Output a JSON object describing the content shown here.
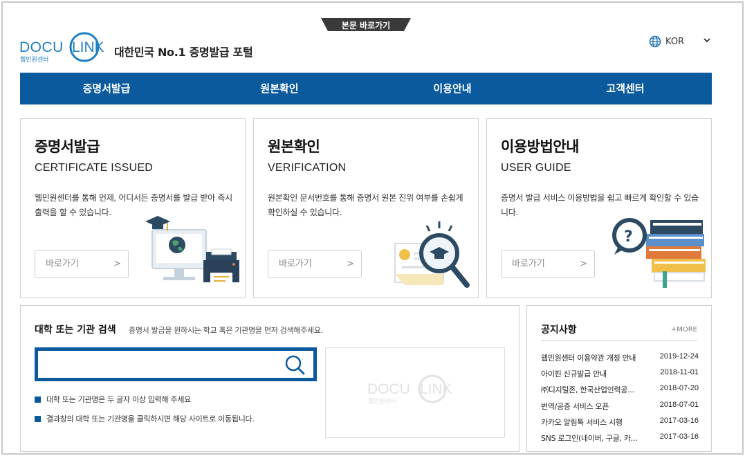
{
  "header": {
    "skip_link": "본문 바로가기",
    "logo_text": "DOCU LINK",
    "logo_sub": "웹민원센터",
    "tagline": "대한민국 No.1 증명발급 포털",
    "language": "KOR"
  },
  "nav": [
    "증명서발급",
    "원본확인",
    "이용안내",
    "고객센터"
  ],
  "cards": [
    {
      "title": "증명서발급",
      "subtitle": "CERTIFICATE ISSUED",
      "desc": "웹민원센터를 통해 언제, 어디서든 증명서를 발급 받아 즉시출력을 할 수 있습니다.",
      "button": "바로가기"
    },
    {
      "title": "원본확인",
      "subtitle": "VERIFICATION",
      "desc": "원본확인 문서번호를 통해 증명서 원본 진위 여부를 손쉽게 확인하실 수 있습니다.",
      "button": "바로가기"
    },
    {
      "title": "이용방법안내",
      "subtitle": "USER GUIDE",
      "desc": "증명서 발급 서비스 이용방법을 쉽고 빠르게 확인할 수 있습니다.",
      "button": "바로가기"
    }
  ],
  "search": {
    "title": "대학 또는 기관 검색",
    "subtitle": "증명서 발급을 원하시는 학교 혹은 기관명을 먼저 검색해주세요.",
    "input_value": "",
    "hints": [
      "대학 또는 기관명은 두 글자 이상 입력해 주세요",
      "결과창의 대학 또는 기관명을 클릭하시면 해당 사이트로 이동됩니다."
    ],
    "watermark": "DOCU LINK",
    "watermark_sub": "웹민원센터"
  },
  "notice": {
    "title": "공지사항",
    "more": "+MORE",
    "items": [
      {
        "title": "웹민원센터 이용약관 개정 안내",
        "date": "2019-12-24"
      },
      {
        "title": "아이핀 신규발급 안내",
        "date": "2018-11-01"
      },
      {
        "title": "㈜디지털존, 한국산업인력공...",
        "date": "2018-07-20"
      },
      {
        "title": "번역/공증 서비스 오픈",
        "date": "2018-07-01"
      },
      {
        "title": "카카오 알림톡 서비스 시행",
        "date": "2017-03-16"
      },
      {
        "title": "SNS 로그인(네이버, 구글, 카...",
        "date": "2017-03-16"
      }
    ]
  },
  "colors": {
    "brand_blue": "#0b5a9e",
    "logo_blue": "#1e7fc3",
    "border": "#cfcfcf"
  }
}
